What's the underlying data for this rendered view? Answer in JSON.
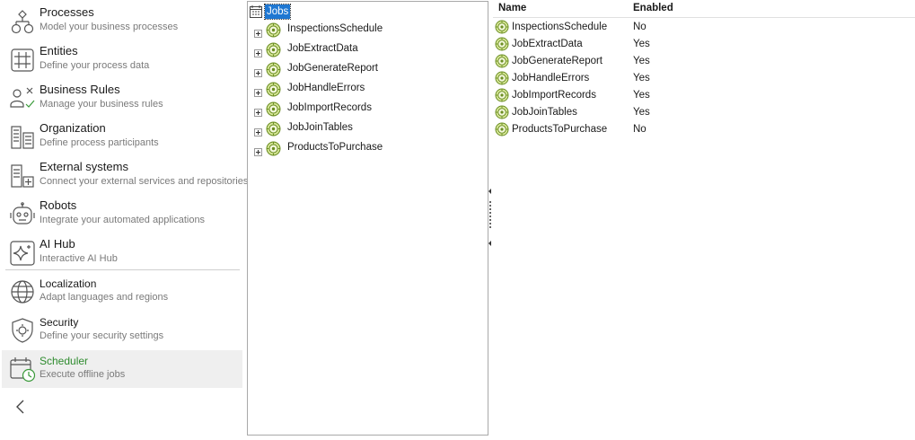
{
  "nav": {
    "items": [
      {
        "title": "Processes",
        "subtitle": "Model your business processes"
      },
      {
        "title": "Entities",
        "subtitle": "Define your process data"
      },
      {
        "title": "Business Rules",
        "subtitle": "Manage your business rules"
      },
      {
        "title": "Organization",
        "subtitle": "Define process participants"
      },
      {
        "title": "External systems",
        "subtitle": "Connect your external services and repositories"
      },
      {
        "title": "Robots",
        "subtitle": "Integrate your automated applications"
      },
      {
        "title": "AI Hub",
        "subtitle": "Interactive AI Hub"
      },
      {
        "title": "Localization",
        "subtitle": "Adapt languages and regions"
      },
      {
        "title": "Security",
        "subtitle": "Define your security settings"
      },
      {
        "title": "Scheduler",
        "subtitle": "Execute offline jobs"
      }
    ],
    "selected_color": "#2e8b2e",
    "collapse_icon": "chevron-left-icon"
  },
  "tree": {
    "root_label": "Jobs",
    "root_icon": "calendar-icon",
    "item_icon": "gear-icon",
    "items": [
      "InspectionsSchedule",
      "JobExtractData",
      "JobGenerateReport",
      "JobHandleErrors",
      "JobImportRecords",
      "JobJoinTables",
      "ProductsToPurchase"
    ]
  },
  "list": {
    "headers": {
      "name": "Name",
      "enabled": "Enabled"
    },
    "rows": [
      {
        "name": "InspectionsSchedule",
        "enabled": "No"
      },
      {
        "name": "JobExtractData",
        "enabled": "Yes"
      },
      {
        "name": "JobGenerateReport",
        "enabled": "Yes"
      },
      {
        "name": "JobHandleErrors",
        "enabled": "Yes"
      },
      {
        "name": "JobImportRecords",
        "enabled": "Yes"
      },
      {
        "name": "JobJoinTables",
        "enabled": "Yes"
      },
      {
        "name": "ProductsToPurchase",
        "enabled": "No"
      }
    ]
  },
  "colors": {
    "selection": "#1e77d2",
    "gear_fill": "#d9e89a",
    "gear_stroke": "#6b8e23"
  }
}
